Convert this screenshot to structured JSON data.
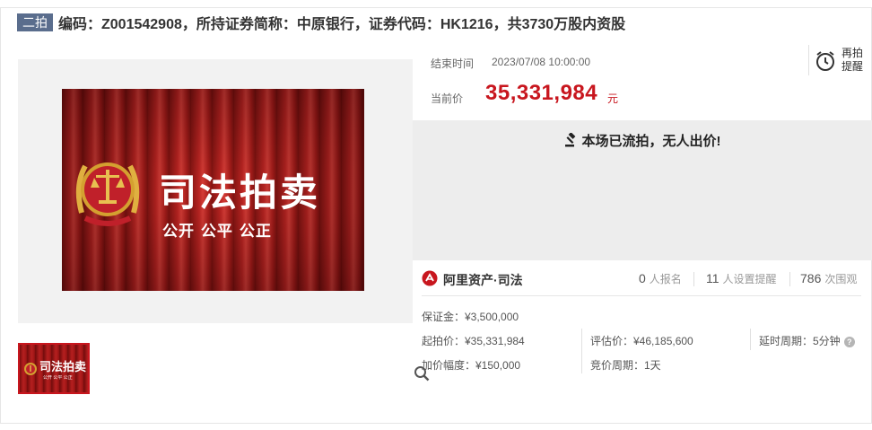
{
  "header": {
    "round_tag": "二拍",
    "title": "编码：Z001542908，所持证券简称：中原银行，证券代码：HK1216，共3730万股内资股"
  },
  "media": {
    "banner_title": "司法拍卖",
    "banner_subtitle": "公开 公平 公正",
    "thumb_title": "司法拍卖",
    "thumb_subtitle": "公开 公平 公正"
  },
  "auction": {
    "end_time_label": "结束时间",
    "end_time_value": "2023/07/08 10:00:00",
    "current_price_label": "当前价",
    "current_price_value": "35,331,984",
    "current_price_unit": "元",
    "remind_label": "再拍提醒",
    "status_text": "本场已流拍，无人出价!"
  },
  "platform": {
    "name": "阿里资产·司法",
    "signups_count": "0",
    "signups_unit": "人报名",
    "reminders_count": "11",
    "reminders_unit": "人设置提醒",
    "views_count": "786",
    "views_unit": "次围观"
  },
  "details": {
    "deposit": "保证金：¥3,500,000",
    "starting_price": "起拍价：¥35,331,984",
    "appraisal_price": "评估价：¥46,185,600",
    "delay_period": "延时周期：5分钟",
    "increment": "加价幅度：¥150,000",
    "bidding_period": "竞价周期：1天"
  },
  "colors": {
    "accent_red": "#c8161e",
    "tag_bg": "#5a6d8d",
    "status_bg": "#ededed"
  },
  "icons": [
    "search-zoom-icon",
    "alarm-clock-icon",
    "gavel-icon",
    "ali-asset-logo-icon",
    "help-icon",
    "court-emblem-icon"
  ]
}
